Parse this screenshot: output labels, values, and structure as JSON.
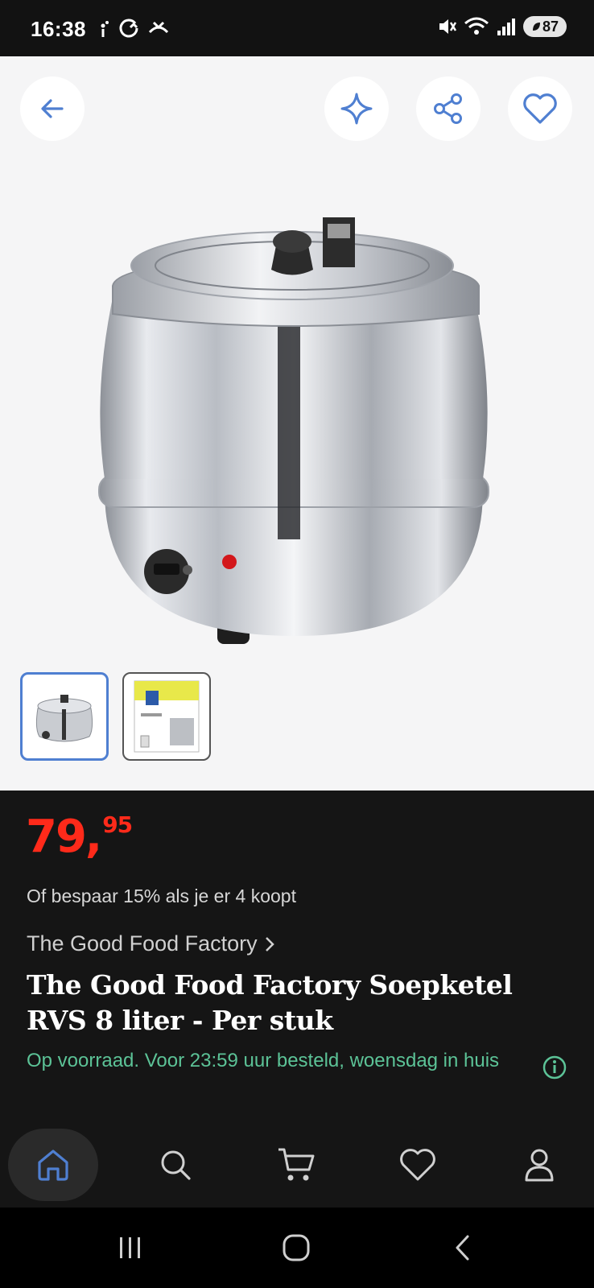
{
  "status_bar": {
    "time": "16:38",
    "battery_level": "87"
  },
  "gallery": {
    "buttons": {
      "back": "back",
      "highlight": "sparkle",
      "share": "share",
      "wishlist": "heart"
    },
    "thumbnails": [
      {
        "label": "soup-kettle-photo",
        "selected": true
      },
      {
        "label": "box-photo",
        "selected": false
      }
    ]
  },
  "product": {
    "price_whole": "79,",
    "price_cents": "95",
    "promo_text": "Of bespaar 15% als je er 4 koopt",
    "brand": "The Good Food Factory",
    "title": "The Good Food Factory Soepketel RVS 8 liter - Per stuk",
    "availability": "Op voorraad. Voor 23:59 uur besteld, woensdag in huis"
  },
  "colors": {
    "price": "#ff2a1a",
    "accent": "#4f7fd1",
    "availability": "#5cc397"
  },
  "bottom_nav": [
    "home",
    "search",
    "cart",
    "wishlist",
    "account"
  ]
}
